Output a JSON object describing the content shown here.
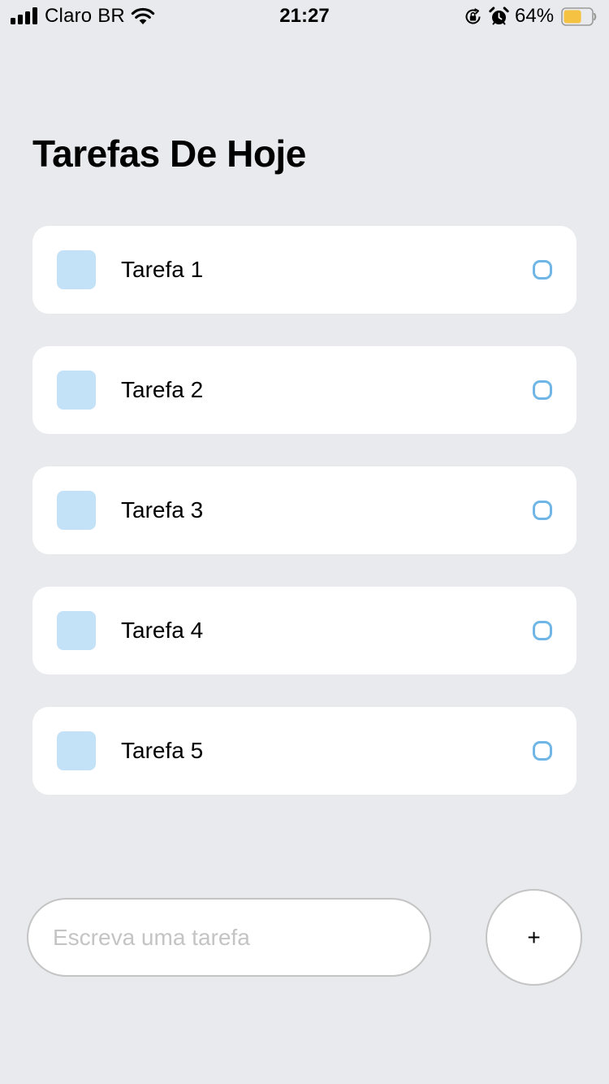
{
  "status_bar": {
    "carrier": "Claro BR",
    "time": "21:27",
    "battery_percent": "64%",
    "battery_level": 0.64,
    "battery_color": "#f5c242",
    "icons": [
      "signal-bars-icon",
      "wifi-icon",
      "rotation-lock-icon",
      "alarm-icon",
      "battery-icon"
    ]
  },
  "header": {
    "title": "Tarefas De Hoje"
  },
  "tasks": [
    {
      "label": "Tarefa 1",
      "completed": false
    },
    {
      "label": "Tarefa 2",
      "completed": false
    },
    {
      "label": "Tarefa 3",
      "completed": false
    },
    {
      "label": "Tarefa 4",
      "completed": false
    },
    {
      "label": "Tarefa 5",
      "completed": false
    }
  ],
  "composer": {
    "placeholder": "Escreva uma tarefa",
    "value": "",
    "add_label": "+"
  },
  "colors": {
    "background": "#e8eaed",
    "card": "#ffffff",
    "task_square": "#c3e1f7",
    "task_circle": "#6fb6e6",
    "border": "#c4c4c4"
  }
}
